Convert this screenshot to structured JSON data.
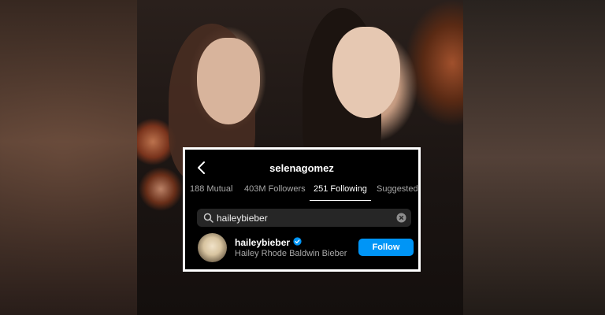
{
  "profile": {
    "username": "selenagomez"
  },
  "tabs": [
    {
      "label": "188 Mutual"
    },
    {
      "label": "403M Followers"
    },
    {
      "label": "251 Following",
      "active": true
    },
    {
      "label": "Suggested"
    }
  ],
  "search": {
    "value": "haileybieber",
    "icon": "search-icon",
    "clear_icon": "clear-icon"
  },
  "result": {
    "username": "haileybieber",
    "verified": true,
    "full_name": "Hailey Rhode Baldwin Bieber",
    "follow_label": "Follow"
  },
  "colors": {
    "accent": "#0095f6",
    "panel_bg": "#000000",
    "border": "#ffffff",
    "muted_text": "#a8a8a8"
  }
}
